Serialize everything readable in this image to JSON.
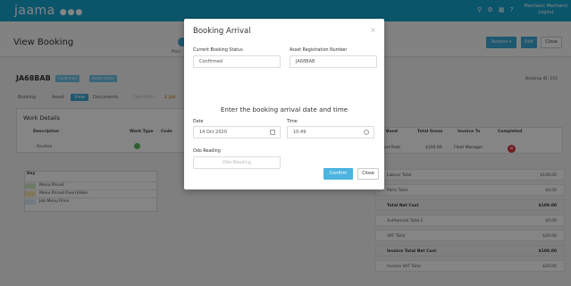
{
  "app": {
    "logo": "jaama",
    "logo_dots": "●●●",
    "user_name": "Mechanic Mechanic",
    "user_action": "Logout"
  },
  "header": {
    "title": "View Booking",
    "actions_label": "Actions ▾",
    "edit_label": "Edit",
    "close_label": "Close",
    "progress_label": "Provi"
  },
  "booking": {
    "registration": "JA68BAB",
    "status_badge": "Confirmed",
    "asset_badge": "Asset Active",
    "booking_id": "Booking ID: 153"
  },
  "tabs": [
    {
      "label": "Booking"
    },
    {
      "label": "Asset"
    },
    {
      "label": "View"
    },
    {
      "label": "Documents"
    },
    {
      "label": "Checklists"
    },
    {
      "label": "£ Job"
    }
  ],
  "work_details": {
    "title": "Work Details",
    "columns": [
      "Description",
      "Work Type",
      "Code"
    ],
    "rows": [
      {
        "description": "- Routine"
      }
    ]
  },
  "key": {
    "title": "Key",
    "items": [
      {
        "label": "Menu Priced",
        "color": "#cfe8c4"
      },
      {
        "label": "Menu Priced Overridden",
        "color": "#f7e2b3"
      },
      {
        "label": "Job Menu Price",
        "color": "#dbe9f5"
      }
    ]
  },
  "right_table": {
    "columns": [
      "Band",
      "Total Gross",
      "Invoice To",
      "Completed"
    ],
    "row": {
      "band": "ort Rate",
      "total_gross": "$100.00",
      "invoice_to": "Fleet Manager"
    }
  },
  "totals": [
    {
      "label": "Labour Total",
      "value": "$100.00",
      "bold": false
    },
    {
      "label": "Parts Total",
      "value": "$0.00",
      "bold": false
    },
    {
      "label": "Total Net Cost",
      "value": "$100.00",
      "bold": true
    },
    {
      "label": "Authorised Total £",
      "value": "$0.00",
      "bold": false
    },
    {
      "label": "VAT Total",
      "value": "$20.00",
      "bold": false
    },
    {
      "label": "Invoice Total Net Cost",
      "value": "$100.00",
      "bold": true
    },
    {
      "label": "Invoice VAT Total",
      "value": "$20.00",
      "bold": false
    }
  ],
  "modal": {
    "title": "Booking Arrival",
    "close_symbol": "×",
    "status_label": "Current Booking Status",
    "status_value": "Confirmed",
    "asset_reg_label": "Asset Registration Number",
    "asset_reg_value": "JA68BAB",
    "instruction": "Enter the booking arrival date and time",
    "date_label": "Date",
    "date_value": "14 Oct 2020",
    "time_label": "Time",
    "time_value": "10:49",
    "odo_label": "Odo Reading",
    "odo_placeholder": "Odo Reading",
    "confirm_label": "Confirm",
    "close_label": "Close"
  },
  "colors": {
    "brand": "#16a4cd",
    "button": "#3ba9d8",
    "confirmed_badge": "#6bc3e7",
    "asset_badge": "#6bc3e7",
    "danger": "#d9363e",
    "success": "#5ab75c"
  }
}
